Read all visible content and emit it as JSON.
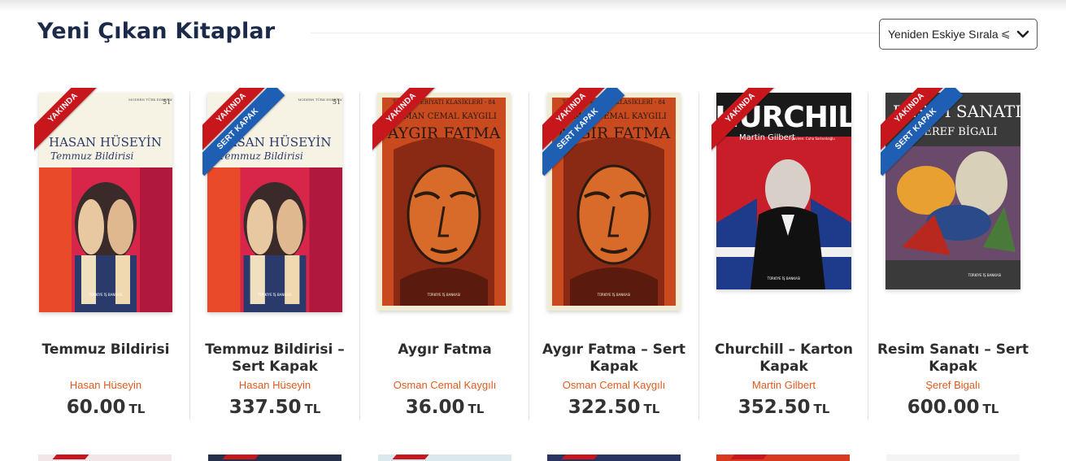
{
  "section": {
    "title": "Yeni Çıkan Kitaplar",
    "sort": {
      "selected": "Yeniden Eskiye Sırala",
      "glyph": "⩽"
    }
  },
  "badges": {
    "coming_soon": "YAKINDA",
    "hardcover": "SERT KAPAK"
  },
  "currency": "TL",
  "books": [
    {
      "title": "Temmuz Bildirisi",
      "author": "Hasan Hüseyin",
      "price": "60.00",
      "badges": [
        "coming_soon"
      ],
      "cover": {
        "series": "MODERN TÜRK EDEBİYATI KLASİKLERİ",
        "number": "51",
        "author": "HASAN HÜSEYİN",
        "title": "Temmuz Bildirisi",
        "publisher": "TÜRKİYE İŞ BANKASI"
      }
    },
    {
      "title": "Temmuz Bildirisi – Sert Kapak",
      "author": "Hasan Hüseyin",
      "price": "337.50",
      "badges": [
        "coming_soon",
        "hardcover"
      ],
      "cover": {
        "series": "MODERN TÜRK EDEBİYATI KLASİKLERİ",
        "number": "51",
        "author": "HASAN HÜSEYİN",
        "title": "Temmuz Bildirisi",
        "publisher": "TÜRKİYE İŞ BANKASI"
      }
    },
    {
      "title": "Aygır Fatma",
      "author": "Osman Cemal Kaygılı",
      "price": "36.00",
      "badges": [
        "coming_soon"
      ],
      "cover": {
        "series": "TÜRK EDEBİYATI KLASİKLERİ - 84",
        "author": "OSMAN CEMAL KAYGILI",
        "title": "AYGIR FATMA",
        "publisher": "TÜRKİYE İŞ BANKASI"
      }
    },
    {
      "title": "Aygır Fatma – Sert Kapak",
      "author": "Osman Cemal Kaygılı",
      "price": "322.50",
      "badges": [
        "coming_soon",
        "hardcover"
      ],
      "cover": {
        "series": "TÜRK EDEBİYATI KLASİKLERİ - 84",
        "author": "OSMAN CEMAL KAYGILI",
        "title": "AYGIR FATMA",
        "publisher": "TÜRKİYE İŞ BANKASI"
      }
    },
    {
      "title": "Churchill – Karton Kapak",
      "author": "Martin Gilbert",
      "price": "352.50",
      "badges": [
        "coming_soon"
      ],
      "cover": {
        "title": "CHURCHILL",
        "author": "Martin Gilbert",
        "translator": "Çeviren: Cuha Sarisınlıoğlu",
        "publisher": "TÜRKİYE İŞ BANKASI"
      }
    },
    {
      "title": "Resim Sanatı – Sert Kapak",
      "author": "Şeref Bigalı",
      "price": "600.00",
      "badges": [
        "coming_soon",
        "hardcover"
      ],
      "cover": {
        "title": "RESİM SANATI",
        "author": "ŞEREF BİGALI",
        "publisher": "TÜRKİYE İŞ BANKASI"
      }
    }
  ]
}
